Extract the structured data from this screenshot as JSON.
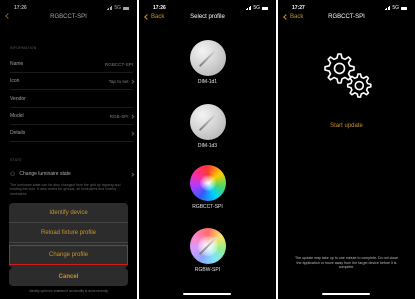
{
  "screen1": {
    "time": "17:26",
    "network": "5G",
    "title": "RGBCCT-SPI",
    "information_header": "INFORMATION",
    "rows": [
      {
        "label": "Name",
        "value": "RGBCCT-SPI"
      },
      {
        "label": "Icon",
        "value": "Tap to set"
      },
      {
        "label": "Vendor",
        "value": ""
      },
      {
        "label": "Model",
        "value": "RGB-SPI"
      },
      {
        "label": "Details",
        "value": ""
      }
    ],
    "state_header": "STATE",
    "change_state_label": "Change luminaire state",
    "state_description": "The luminaire state can be also changed from the grid by tapping and holding the icon. It also works for groups, all luminaires and nearby luminaires.",
    "sheet": {
      "identify": "Identify device",
      "reload": "Reload fixture profile",
      "change_profile": "Change profile",
      "cancel": "Cancel"
    },
    "bottom_note": "Identify option is enabled if an identify is done recently"
  },
  "screen2": {
    "time": "17:26",
    "network": "5G",
    "back_label": "Back",
    "title": "Select profile",
    "profiles": [
      {
        "label": "DIM-1d1"
      },
      {
        "label": "DIM-1d3"
      },
      {
        "label": "RGBCCT-SPI"
      },
      {
        "label": "RGBW-SPI"
      }
    ]
  },
  "screen3": {
    "time": "17:27",
    "network": "5G",
    "back_label": "Back",
    "title": "RGBCCT-SPI",
    "start_update": "Start update",
    "notice": "The update may take up to one minute to complete. Do not close the application or move away from the target device before it is complete."
  },
  "colors": {
    "accent": "#c8932c",
    "highlight": "#d11b1b",
    "background": "#000000"
  }
}
